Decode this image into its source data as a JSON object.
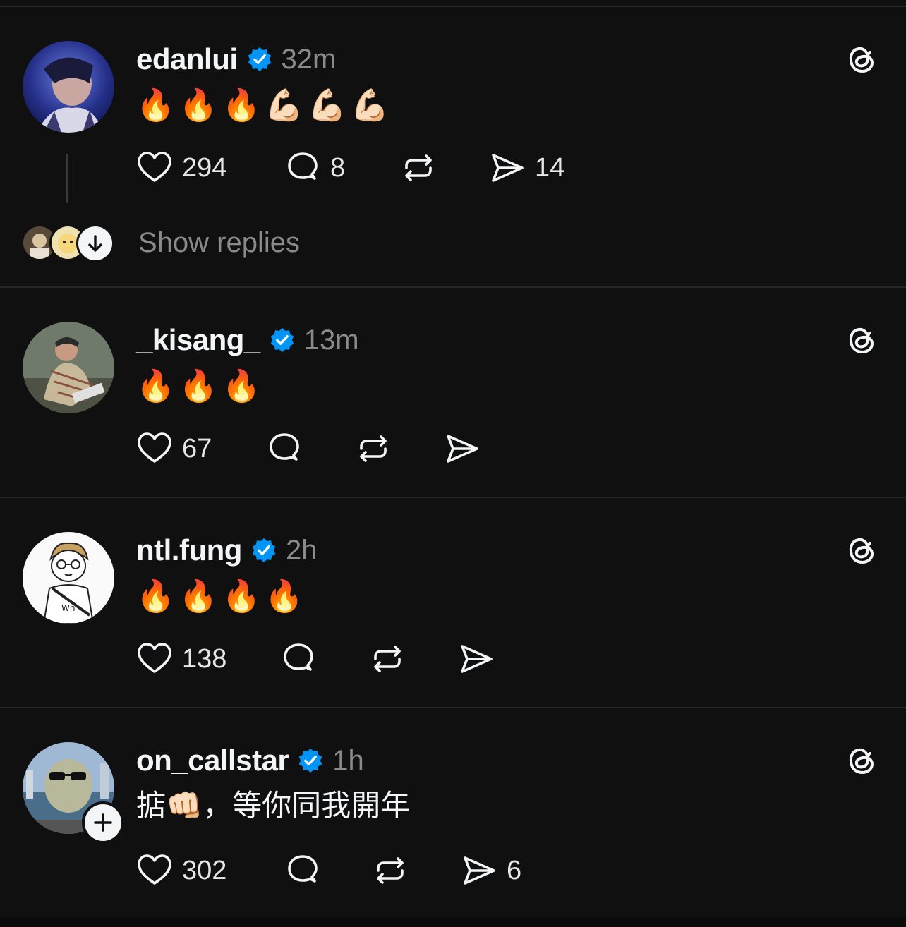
{
  "posts": [
    {
      "username": "edanlui",
      "time": "32m",
      "text": "🔥🔥🔥💪🏻💪🏻💪🏻",
      "likes": "294",
      "comments": "8",
      "reposts": "",
      "shares": "14",
      "show_replies": "Show replies"
    },
    {
      "username": "_kisang_",
      "time": "13m",
      "text": "🔥🔥🔥",
      "likes": "67",
      "comments": "",
      "reposts": "",
      "shares": ""
    },
    {
      "username": "ntl.fung",
      "time": "2h",
      "text": "🔥🔥🔥🔥",
      "likes": "138",
      "comments": "",
      "reposts": "",
      "shares": ""
    },
    {
      "username": "on_callstar",
      "time": "1h",
      "text": "掂👊🏻，等你同我開年",
      "likes": "302",
      "comments": "",
      "reposts": "",
      "shares": "6"
    }
  ],
  "icons": {
    "verified": "verified-badge-icon",
    "threads": "threads-logo-icon",
    "like": "heart-icon",
    "comment": "comment-bubble-icon",
    "repost": "repost-icon",
    "share": "send-icon"
  },
  "colors": {
    "background": "#101010",
    "verified": "#0095f6",
    "muted_text": "#8a8a8a"
  }
}
